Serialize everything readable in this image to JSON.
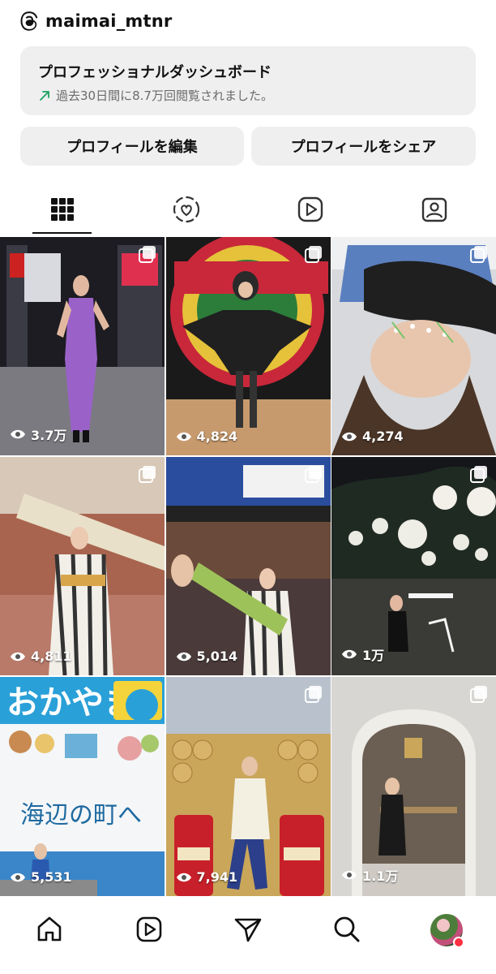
{
  "header": {
    "username": "maimai_mtnr"
  },
  "dashboard": {
    "title": "プロフェッショナルダッシュボード",
    "subtitle": "過去30日間に8.7万回閲覧されました。"
  },
  "buttons": {
    "edit": "プロフィールを編集",
    "share": "プロフィールをシェア"
  },
  "tabs": [
    {
      "icon": "grid-icon",
      "active": true
    },
    {
      "icon": "reels-heart-icon",
      "active": false
    },
    {
      "icon": "play-icon",
      "active": false
    },
    {
      "icon": "tagged-icon",
      "active": false
    }
  ],
  "posts": [
    {
      "views": "3.7万",
      "multiple": true
    },
    {
      "views": "4,824",
      "multiple": true
    },
    {
      "views": "4,274",
      "multiple": true
    },
    {
      "views": "4,811",
      "multiple": true
    },
    {
      "views": "5,014",
      "multiple": true
    },
    {
      "views": "1万",
      "multiple": true
    },
    {
      "views": "5,531",
      "multiple": false
    },
    {
      "views": "7,941",
      "multiple": true
    },
    {
      "views": "1.1万",
      "multiple": true
    }
  ],
  "bottom_nav": [
    "home-icon",
    "reels-icon",
    "send-icon",
    "search-icon",
    "profile-avatar"
  ],
  "colors": {
    "accent": "#1aa260",
    "notification": "#ff3040",
    "surface": "#efeff0"
  }
}
